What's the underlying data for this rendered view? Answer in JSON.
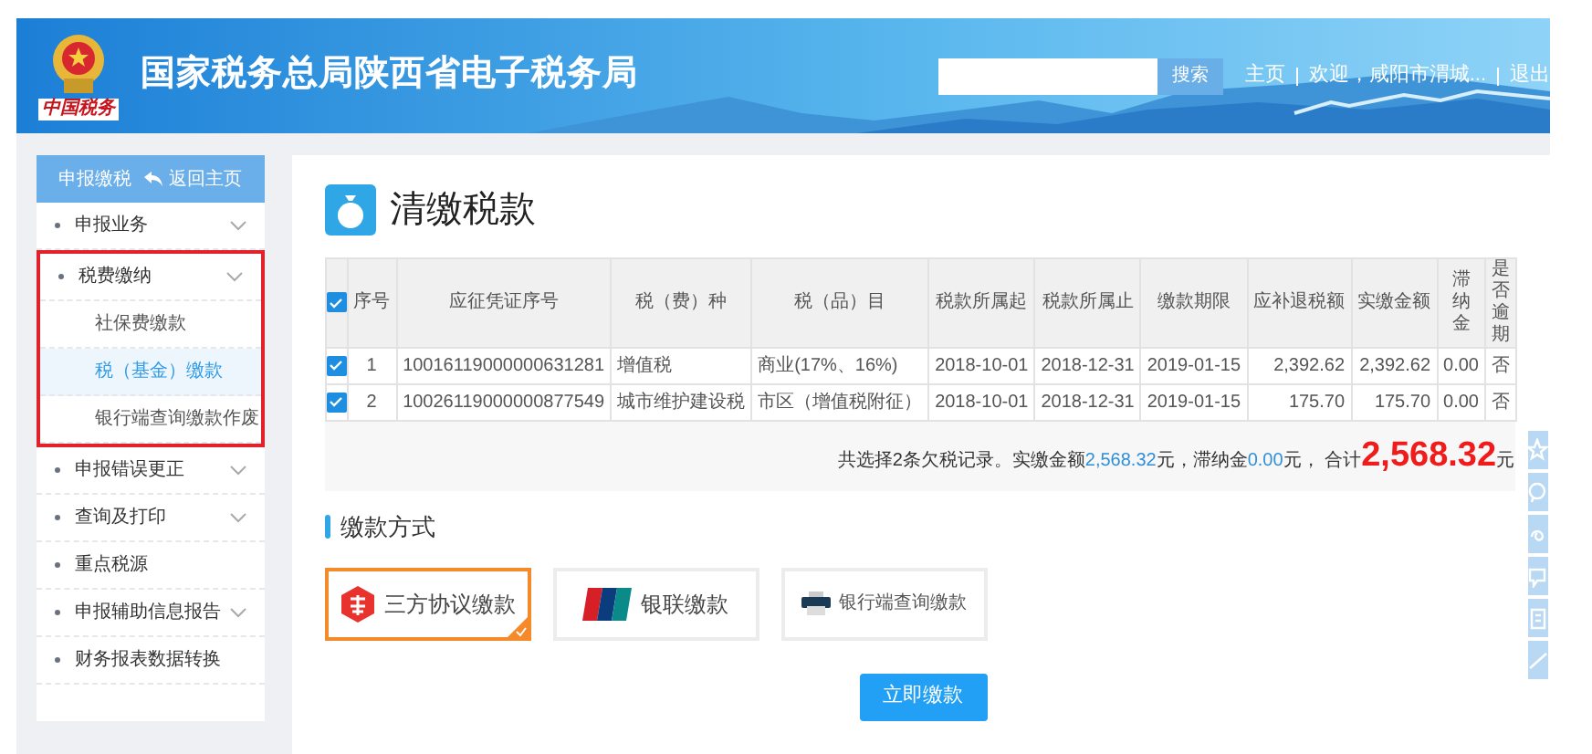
{
  "header": {
    "logo_text": "中国税务",
    "title": "国家税务总局陕西省电子税务局",
    "search": {
      "button": "搜索"
    },
    "links": [
      {
        "label": "主页"
      },
      {
        "label": "欢迎，咸阳市渭城..."
      },
      {
        "label": "退出"
      }
    ]
  },
  "sidebar": {
    "title": "申报缴税",
    "back_link": "返回主页",
    "items": [
      {
        "label": "申报业务",
        "expandable": true,
        "expanded": false
      },
      {
        "label": "税费缴纳",
        "expandable": true,
        "expanded": true,
        "children": [
          {
            "label": "社保费缴款",
            "selected": false
          },
          {
            "label": "税（基金）缴款",
            "selected": true
          },
          {
            "label": "银行端查询缴款作废",
            "selected": false
          }
        ]
      },
      {
        "label": "申报错误更正",
        "expandable": true,
        "expanded": false
      },
      {
        "label": "查询及打印",
        "expandable": true,
        "expanded": false
      },
      {
        "label": "重点税源",
        "expandable": false
      },
      {
        "label": "申报辅助信息报告",
        "expandable": true,
        "expanded": false
      },
      {
        "label": "财务报表数据转换",
        "expandable": false
      }
    ]
  },
  "page": {
    "title": "清缴税款",
    "table": {
      "all_checked": true,
      "columns": [
        "序号",
        "应征凭证序号",
        "税（费）种",
        "税（品）目",
        "税款所属起",
        "税款所属止",
        "缴款期限",
        "应补退税额",
        "实缴金额",
        "滞纳金",
        "是否逾期"
      ],
      "rows": [
        {
          "checked": true,
          "cells": [
            "1",
            "10016119000000631281",
            "增值税",
            "商业(17%、16%)",
            "2018-10-01",
            "2018-12-31",
            "2019-01-15",
            "2,392.62",
            "2,392.62",
            "0.00",
            "否"
          ]
        },
        {
          "checked": true,
          "cells": [
            "2",
            "10026119000000877549",
            "城市维护建设税",
            "市区（增值税附征）",
            "2018-10-01",
            "2018-12-31",
            "2019-01-15",
            "175.70",
            "175.70",
            "0.00",
            "否"
          ]
        }
      ]
    },
    "summary": {
      "text_1": "共选择2条欠税记录。实缴金额",
      "paid": "2,568.32",
      "text_2": " 元，滞纳金 ",
      "late_fee": "0.00",
      "text_3": "元， 合计",
      "total": "2,568.32",
      "unit": "元"
    },
    "payment_section": {
      "title": "缴款方式",
      "options": [
        {
          "kind": "agreement",
          "label": "三方协议缴款",
          "selected": true
        },
        {
          "kind": "unionpay",
          "label": "银联缴款",
          "selected": false
        },
        {
          "kind": "bank",
          "label": "银行端查询缴款",
          "selected": false
        }
      ]
    },
    "submit": "立即缴款"
  }
}
